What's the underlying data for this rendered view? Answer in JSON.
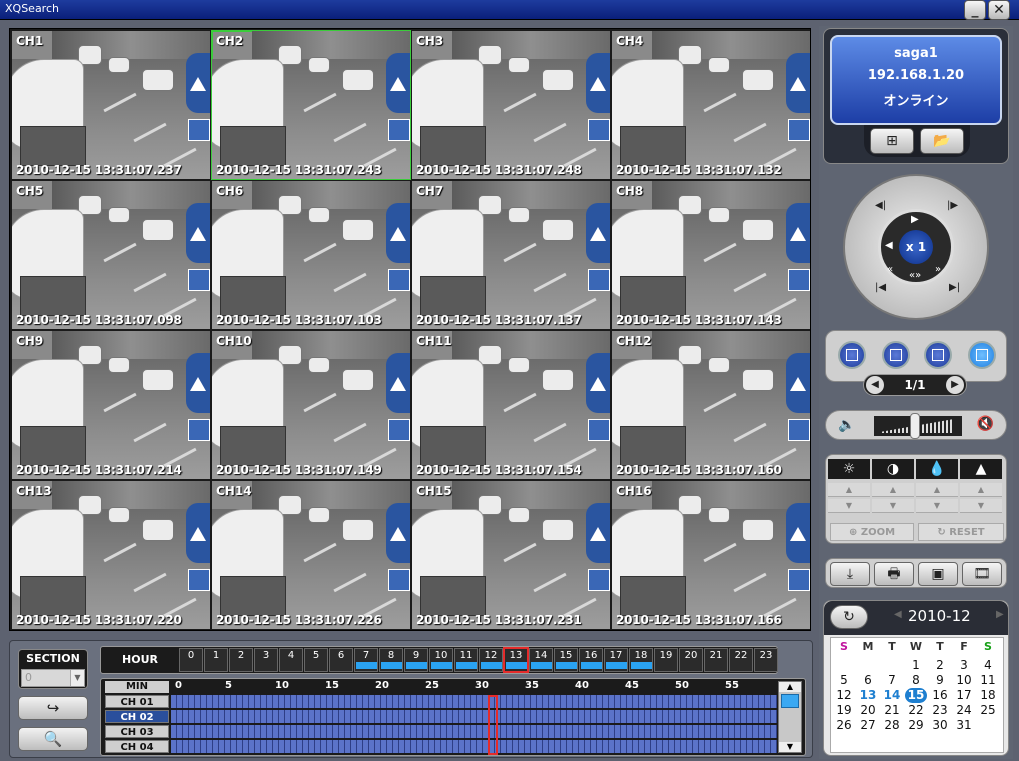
{
  "window": {
    "title": "XQSearch",
    "minimize": "_",
    "close": "✕"
  },
  "cameras": [
    {
      "ch": "CH1",
      "ts": "2010-12-15 13:31:07.237"
    },
    {
      "ch": "CH2",
      "ts": "2010-12-15 13:31:07.243"
    },
    {
      "ch": "CH3",
      "ts": "2010-12-15 13:31:07.248"
    },
    {
      "ch": "CH4",
      "ts": "2010-12-15 13:31:07.132"
    },
    {
      "ch": "CH5",
      "ts": "2010-12-15 13:31:07.098"
    },
    {
      "ch": "CH6",
      "ts": "2010-12-15 13:31:07.103"
    },
    {
      "ch": "CH7",
      "ts": "2010-12-15 13:31:07.137"
    },
    {
      "ch": "CH8",
      "ts": "2010-12-15 13:31:07.143"
    },
    {
      "ch": "CH9",
      "ts": "2010-12-15 13:31:07.214"
    },
    {
      "ch": "CH10",
      "ts": "2010-12-15 13:31:07.149"
    },
    {
      "ch": "CH11",
      "ts": "2010-12-15 13:31:07.154"
    },
    {
      "ch": "CH12",
      "ts": "2010-12-15 13:31:07.160"
    },
    {
      "ch": "CH13",
      "ts": "2010-12-15 13:31:07.220"
    },
    {
      "ch": "CH14",
      "ts": "2010-12-15 13:31:07.226"
    },
    {
      "ch": "CH15",
      "ts": "2010-12-15 13:31:07.231"
    },
    {
      "ch": "CH16",
      "ts": "2010-12-15 13:31:07.166"
    }
  ],
  "selected_channel": "CH2",
  "section": {
    "label": "SECTION",
    "value": "0"
  },
  "hour": {
    "label": "HOUR",
    "hours": [
      "0",
      "1",
      "2",
      "3",
      "4",
      "5",
      "6",
      "7",
      "8",
      "9",
      "10",
      "11",
      "12",
      "13",
      "14",
      "15",
      "16",
      "17",
      "18",
      "19",
      "20",
      "21",
      "22",
      "23"
    ],
    "recorded_from": 7,
    "recorded_to": 18,
    "selected": 13
  },
  "minute": {
    "label": "MIN",
    "ticks": [
      "0",
      "5",
      "10",
      "15",
      "20",
      "25",
      "30",
      "35",
      "40",
      "45",
      "50",
      "55"
    ],
    "channels": [
      "CH 01",
      "CH 02",
      "CH 03",
      "CH 04"
    ],
    "active_channel": "CH 02",
    "selected_minute": 31
  },
  "server": {
    "name": "saga1",
    "ip": "192.168.1.20",
    "status": "オンライン"
  },
  "ptz": {
    "speed": "x 1"
  },
  "pager": {
    "text": "1/1"
  },
  "volume": {
    "level": 0.55
  },
  "image_adjust": {
    "zoom": "ZOOM",
    "reset": "RESET"
  },
  "calendar": {
    "month": "2010-12",
    "weekdays": [
      "S",
      "M",
      "T",
      "W",
      "T",
      "F",
      "S"
    ],
    "days": [
      [
        "",
        "",
        "",
        "1",
        "2",
        "3",
        "4"
      ],
      [
        "5",
        "6",
        "7",
        "8",
        "9",
        "10",
        "11"
      ],
      [
        "12",
        "13",
        "14",
        "15",
        "16",
        "17",
        "18"
      ],
      [
        "19",
        "20",
        "21",
        "22",
        "23",
        "24",
        "25"
      ],
      [
        "26",
        "27",
        "28",
        "29",
        "30",
        "31",
        ""
      ]
    ],
    "recorded": [
      "13",
      "14"
    ],
    "selected": "15"
  },
  "colors": {
    "record_bar": "#2aa3f2",
    "selected_marker": "#e52b2b",
    "selected_cell": "#3bcc3b",
    "calendar_highlight": "#1e7fd0"
  }
}
